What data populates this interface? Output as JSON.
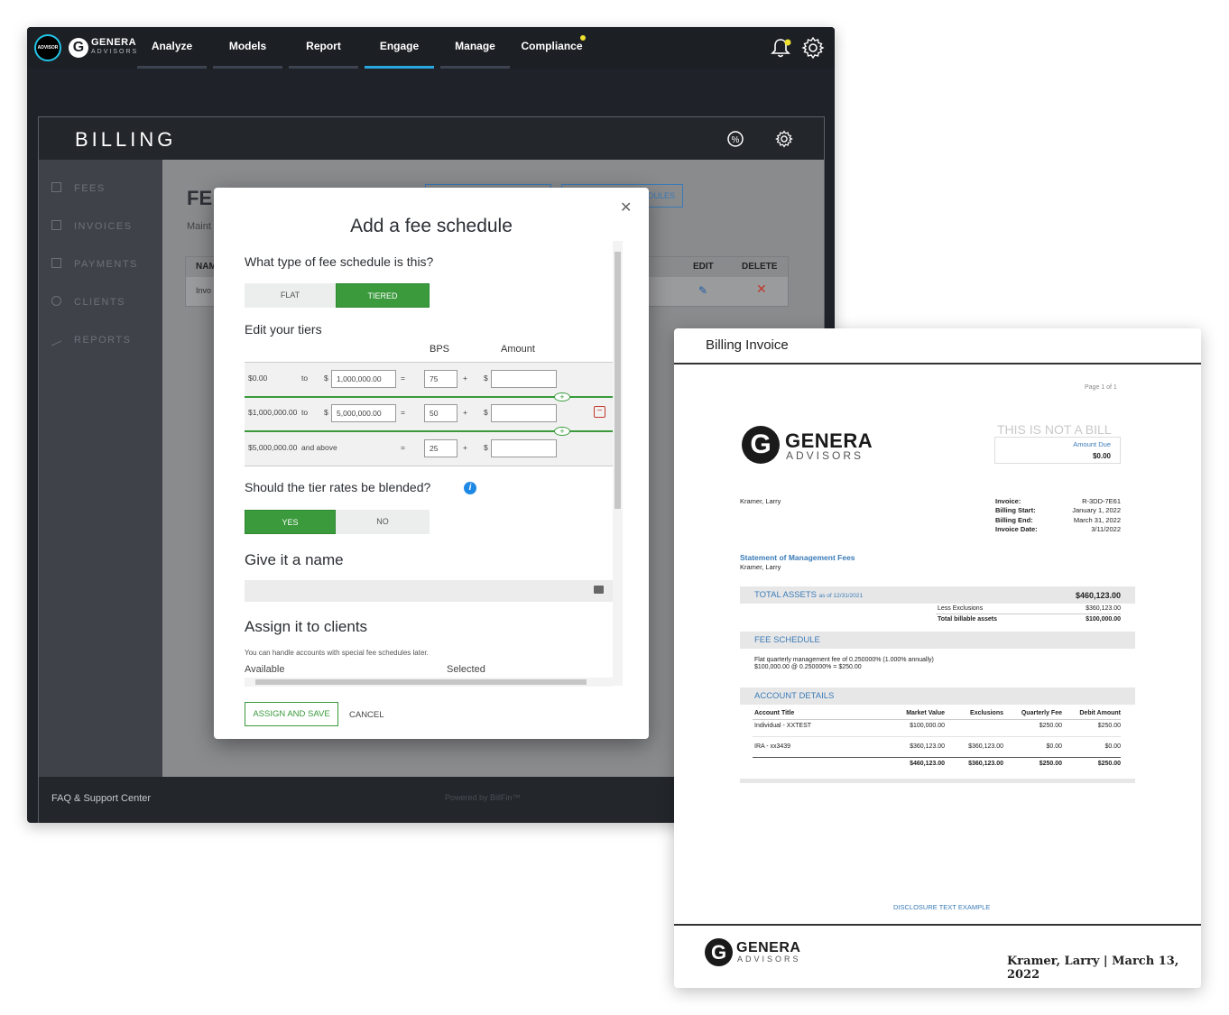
{
  "nav": {
    "advisor_badge": "ADVISOR",
    "logo_title": "GENERA",
    "logo_sub": "ADVISORS",
    "items": [
      "Analyze",
      "Models",
      "Report",
      "Engage",
      "Manage",
      "Compliance"
    ],
    "active_item": "Engage"
  },
  "billing": {
    "title": "BILLING",
    "sidebar": [
      "FEES",
      "INVOICES",
      "PAYMENTS",
      "CLIENTS",
      "REPORTS"
    ],
    "content_title": "FE",
    "content_sub": "Maint",
    "header_btn_right": "DULES",
    "table_headers": {
      "name": "NAM",
      "edit": "EDIT",
      "delete": "DELETE"
    },
    "row_name": "Invo",
    "faq": "FAQ & Support Center",
    "powered": "Powered by BillFin™"
  },
  "modal": {
    "title": "Add a fee schedule",
    "q_type": "What type of fee schedule is this?",
    "type_options": [
      "FLAT",
      "TIERED"
    ],
    "selected_type": "TIERED",
    "edit_tiers": "Edit your tiers",
    "col_bps": "BPS",
    "col_amount": "Amount",
    "tiers": [
      {
        "from": "$0.00",
        "to_word": "to",
        "to_value": "1,000,000.00",
        "eq": "=",
        "bps": "75",
        "plus": "+",
        "currency": "$"
      },
      {
        "from": "$1,000,000.00",
        "to_word": "to",
        "to_value": "5,000,000.00",
        "eq": "=",
        "bps": "50",
        "plus": "+",
        "currency": "$"
      },
      {
        "from": "$5,000,000.00",
        "to_word": "and above",
        "to_value": "",
        "eq": "=",
        "bps": "25",
        "plus": "+",
        "currency": "$"
      }
    ],
    "dollar_prefix": "$",
    "q_blended": "Should the tier rates be blended?",
    "blended_options": [
      "YES",
      "NO"
    ],
    "selected_blended": "YES",
    "give_name": "Give it a name",
    "assign": "Assign it to clients",
    "assign_note": "You can handle accounts with special fee schedules later.",
    "available": "Available",
    "selected": "Selected",
    "btn_assign": "ASSIGN AND SAVE",
    "btn_cancel": "CANCEL"
  },
  "invoice": {
    "header": "Billing Invoice",
    "page_of": "Page 1 of 1",
    "logo_title": "GENERA",
    "logo_sub": "ADVISORS",
    "not_a_bill": "THIS IS NOT A BILL",
    "amount_due_label": "Amount Due",
    "amount_due": "$0.00",
    "client": "Kramer, Larry",
    "meta": [
      {
        "label": "Invoice:",
        "value": "R-3DD-7E61"
      },
      {
        "label": "Billing Start:",
        "value": "January 1, 2022"
      },
      {
        "label": "Billing End:",
        "value": "March 31, 2022"
      },
      {
        "label": "Invoice Date:",
        "value": "3/11/2022"
      }
    ],
    "statement_title": "Statement of Management Fees",
    "statement_client": "Kramer, Larry",
    "total_assets_label": "TOTAL ASSETS",
    "total_assets_asof": "as of 12/31/2021",
    "total_assets_value": "$460,123.00",
    "less_exclusions_label": "Less Exclusions",
    "less_exclusions_value": "$360,123.00",
    "total_billable_label": "Total billable assets",
    "total_billable_value": "$100,000.00",
    "fee_schedule_label": "FEE SCHEDULE",
    "fee_line1": "Flat quarterly management fee of 0.250000% (1.000% annually)",
    "fee_line2": "$100,000.00 @ 0.250000% = $250.00",
    "account_details_label": "ACCOUNT DETAILS",
    "acct_columns": [
      "Account Title",
      "Market Value",
      "Exclusions",
      "Quarterly Fee",
      "Debit Amount"
    ],
    "acct_rows": [
      [
        "Individual - XXTEST",
        "$100,000.00",
        "",
        "$250.00",
        "$250.00"
      ],
      [
        "IRA - xx3439",
        "$360,123.00",
        "$360,123.00",
        "$0.00",
        "$0.00"
      ]
    ],
    "acct_totals": [
      "$460,123.00",
      "$360,123.00",
      "$250.00",
      "$250.00"
    ],
    "disclosure": "DISCLOSURE TEXT EXAMPLE",
    "footer": "Kramer, Larry | March 13, 2022"
  }
}
